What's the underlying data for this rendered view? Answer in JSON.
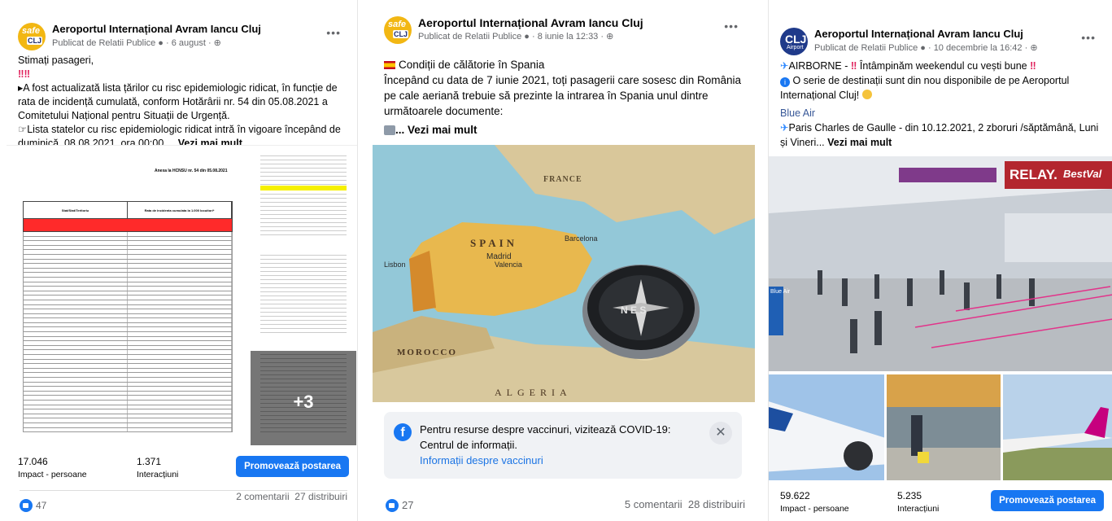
{
  "posts": [
    {
      "page_name": "Aeroportul Internațional Avram Iancu Cluj",
      "author": "Publicat de Relatii Publice",
      "date": "6 august",
      "logo": {
        "top": "safe",
        "bottom": "CLJ"
      },
      "lines": [
        "Stimați pasageri,",
        "‼‼",
        "A fost actualizată lista țărilor cu risc epidemiologic ridicat, în funcție de rata de incidență cumulată, conform Hotărârii nr. 54 din 05.08.2021 a Comitetului Național pentru Situații de Urgență.",
        "Lista statelor cu risc epidemiologic ridicat intră în vigoare începând de duminică, 08.08.2021, ora 00:00...."
      ],
      "see_more": "Vezi mai mult",
      "photo_count_overlay": "+3",
      "doc_title": "Anexa la HCNSU nr. 54 din 05.08.2021",
      "doc_col1": "Stat/Stat/Teritoriu",
      "doc_col2": "Rata de incidenta cumulata la 1.000 locuitori*",
      "reach_value": "17.046",
      "reach_label": "Impact - persoane",
      "engagement_value": "1.371",
      "engagement_label": "Interacțiuni",
      "promote_label": "Promovează postarea",
      "likes": "47",
      "comments": "2 comentarii",
      "shares": "27 distribuiri"
    },
    {
      "page_name": "Aeroportul Internațional Avram Iancu Cluj",
      "author": "Publicat de Relatii Publice",
      "date": "8 iunie la 12:33",
      "logo": {
        "top": "safe",
        "bottom": "CLJ"
      },
      "lines": [
        "Condiții de călătorie în Spania",
        "Începând cu data de 7 iunie 2021, toți pasagerii care sosesc din România pe cale aeriană trebuie să prezinte la intrarea în Spania unul dintre următoarele documente:"
      ],
      "see_more": "... Vezi mai mult",
      "map_labels": {
        "france": "FRANCE",
        "spain": "SPAIN",
        "madrid": "Madrid",
        "barcelona": "Barcelona",
        "valencia": "Valencia",
        "lisbon": "Lisbon",
        "morocco": "MOROCCO",
        "algeria": "ALGERIA",
        "compass": "N E S"
      },
      "covid_text": "Pentru resurse despre vaccinuri, vizitează COVID-19: Centrul de informații.",
      "covid_link": "Informații despre vaccinuri",
      "likes": "27",
      "comments": "5 comentarii",
      "shares": "28 distribuiri"
    },
    {
      "page_name": "Aeroportul Internațional Avram Iancu Cluj",
      "author": "Publicat de Relatii Publice",
      "date": "10 decembrie la 16:42",
      "logo": {
        "top": "CLJ",
        "bottom": "Airport"
      },
      "line1_a": "AIRBORNE - ",
      "line1_b": " Întâmpinăm weekendul cu vești bune ",
      "line2": "O serie de destinații sunt din nou disponibile de pe Aeroportul Internațional Cluj!",
      "airline": "Blue Air",
      "route": "Paris Charles de Gaulle  - din 10.12.2021, 2 zboruri /săptămână, Luni și Vineri...",
      "see_more": "Vezi mai mult",
      "terminal_signs": {
        "relay": "RELAY.",
        "bestval": "BestVal",
        "blueair": "Blue Air"
      },
      "reach_value": "59.622",
      "reach_label": "Impact - persoane",
      "engagement_value": "5.235",
      "engagement_label": "Interacțiuni",
      "promote_label": "Promovează postarea"
    }
  ],
  "colors": {
    "accent": "#1877f2",
    "meta": "#65676b",
    "alert_red": "#e0245e"
  }
}
